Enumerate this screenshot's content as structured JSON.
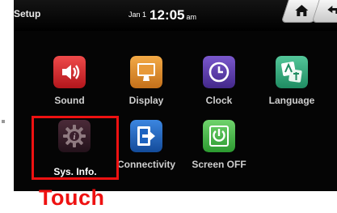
{
  "header": {
    "title": "Setup",
    "date": "Jan 1",
    "time": "12:05",
    "ampm": "am"
  },
  "apps": [
    {
      "id": "sound",
      "label": "Sound",
      "icon": "speaker-icon",
      "color": "#d3262b"
    },
    {
      "id": "display",
      "label": "Display",
      "icon": "monitor-icon",
      "color": "#e2902a"
    },
    {
      "id": "clock",
      "label": "Clock",
      "icon": "clock-icon",
      "color": "#5a3aa8"
    },
    {
      "id": "language",
      "label": "Language",
      "icon": "language-icon",
      "color": "#31a77c"
    },
    {
      "id": "sys-info",
      "label": "Sys. Info.",
      "icon": "gear-info-icon",
      "color": "#3a1f2c"
    },
    {
      "id": "connectivity",
      "label": "Connectivity",
      "icon": "exit-arrow-icon",
      "color": "#1d63c0"
    },
    {
      "id": "screen-off",
      "label": "Screen OFF",
      "icon": "power-icon",
      "color": "#42b646"
    }
  ],
  "annotation": {
    "label": "Touch",
    "color": "#ee1111"
  }
}
